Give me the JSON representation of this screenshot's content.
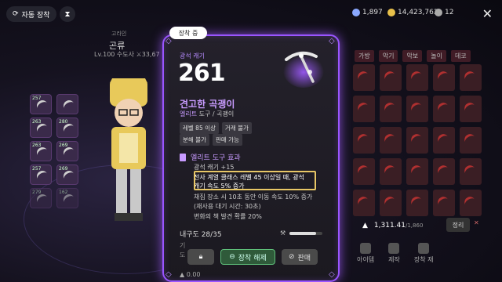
{
  "top_left": {
    "auto_equip_label": "자동 장착",
    "auto_equip_icon": "refresh-icon",
    "hourglass_icon": "hourglass-icon"
  },
  "character": {
    "title": "고라인",
    "name": "곤류",
    "level_text": "Lv.100 수도사 ⚔33,67"
  },
  "inventory_left": [
    {
      "count": "257"
    },
    {
      "count": ""
    },
    {
      "count": "263"
    },
    {
      "count": "280"
    },
    {
      "count": "263"
    },
    {
      "count": "269"
    },
    {
      "count": "257"
    },
    {
      "count": "269"
    },
    {
      "count": "279"
    },
    {
      "count": "162"
    }
  ],
  "currency": {
    "gems": "1,897",
    "gold": "14,423,763",
    "tickets": "12"
  },
  "tabs": [
    "가방",
    "악기",
    "악보",
    "놀이",
    "데코"
  ],
  "bottom_bar": {
    "amount": "1,311.41",
    "max": "/1,860",
    "sort_label": "정리"
  },
  "bottom_menu": [
    "아이템",
    "제작",
    "장착 재"
  ],
  "card": {
    "equipped_badge": "장착 중",
    "stat_label": "광석 캐기",
    "stat_value": "261",
    "item_name": "견고한 곡괭이",
    "grade": "엘리트",
    "category": " 도구 / 곡괭이",
    "tags_row1": [
      "레벨 85 이상",
      "거래 불가"
    ],
    "tags_row2": [
      "분해 불가",
      "판매 가능"
    ],
    "effect_title": "엘리트 도구 효과",
    "effects": [
      "광석 캐기 +15",
      "전사 계열 클래스 레벨 45 이상일 때, 광석",
      "캐기 속도 5% 증가",
      "채집 장소 시 10초 동안 이동 속도 10% 증가",
      "(재사용 대기 시간: 30초)",
      "변화의 책 발견 확률 20%"
    ],
    "durability_label": "내구도 28/35",
    "durability_fraction": 0.8,
    "fade_lines": [
      "기",
      "도"
    ],
    "buttons": {
      "lock_icon": "lock-icon",
      "unequip": "장착 해제",
      "sell": "판매"
    },
    "price": "0.00",
    "colors": {
      "border": "#9a55ff",
      "accent": "#c89bff",
      "highlight": "#e8c766"
    }
  }
}
